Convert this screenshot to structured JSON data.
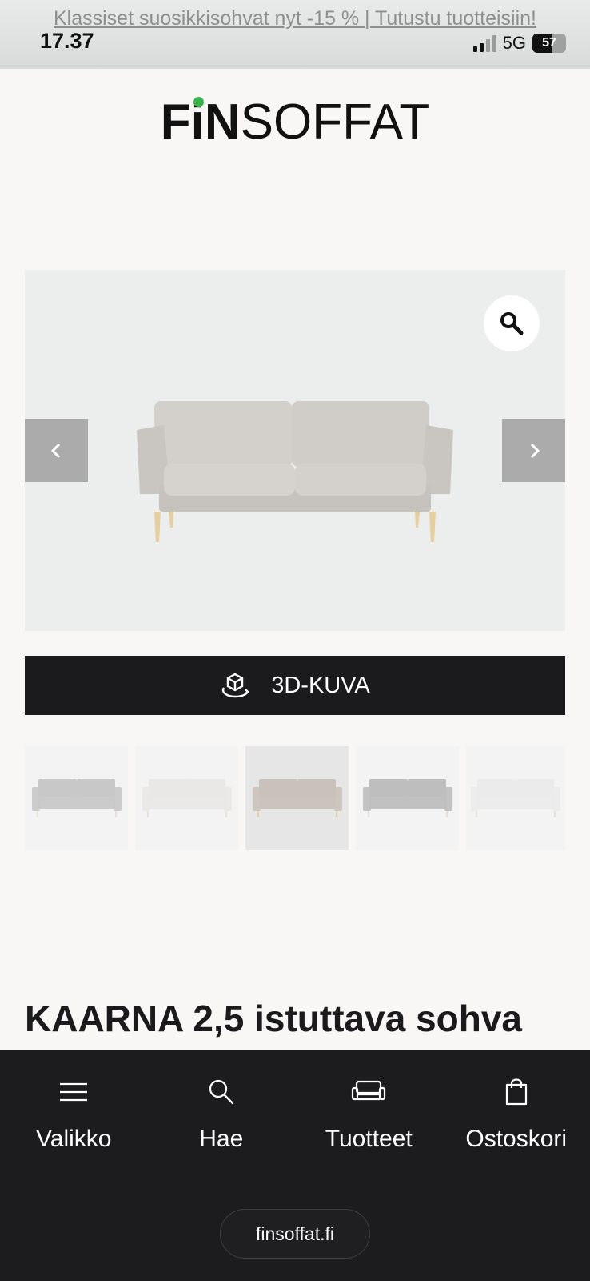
{
  "status_bar": {
    "time": "17.37",
    "network": "5G",
    "battery": "57",
    "battery_level": 0.57
  },
  "promo_banner": {
    "text": "Klassiset suosikkisohvat nyt -15 % | Tutustu tuotteisiin!"
  },
  "logo": {
    "fin": "FiN",
    "soffat": "SOFFAT",
    "dot_color": "#3bb54a"
  },
  "gallery": {
    "zoom_icon": "magnifier-icon",
    "prev_icon": "chevron-left-icon",
    "next_icon": "chevron-right-icon"
  },
  "view_3d": {
    "icon": "cube-rotate-icon",
    "label": "3D-KUVA"
  },
  "thumbnails": {
    "active_index": 2,
    "fabric_colors": [
      "#c8c8c8",
      "#e9e8e6",
      "#c9c2ba",
      "#bebebf",
      "#ebebeb"
    ]
  },
  "product": {
    "title": "KAARNA 2,5 istuttava sohva"
  },
  "bottom_nav": {
    "items": [
      {
        "label": "Valikko",
        "icon": "menu-icon"
      },
      {
        "label": "Hae",
        "icon": "search-icon"
      },
      {
        "label": "Tuotteet",
        "icon": "sofa-icon"
      },
      {
        "label": "Ostoskori",
        "icon": "shopping-bag-icon"
      }
    ],
    "url": "finsoffat.fi"
  },
  "colors": {
    "nav_background": "#1c1c1e",
    "button_dark": "#1b1b1d",
    "page_background": "#f8f7f5"
  }
}
